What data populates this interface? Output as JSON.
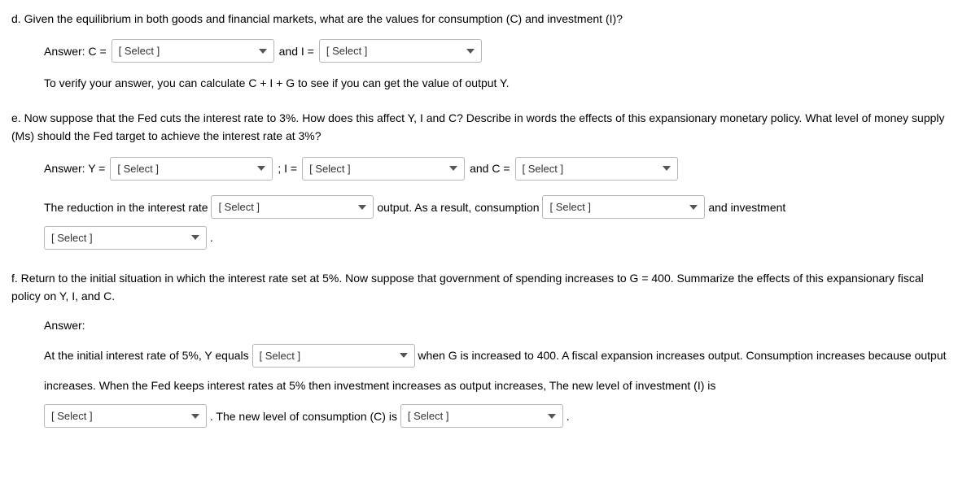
{
  "d": {
    "question": "d. Given the equilibrium in both goods and financial markets, what are the values for consumption (C) and investment (I)?",
    "answer_c_label": "Answer: C =",
    "and_i_label": "and I =",
    "verify": "To verify your answer, you can calculate C + I + G to see if you can get the value of output Y."
  },
  "e": {
    "question": "e. Now suppose that the Fed cuts the interest rate to 3%. How does this affect Y, I and C? Describe in words the effects of this expansionary monetary policy. What level of money supply (Ms) should the Fed target to achieve the interest rate at 3%?",
    "answer_y_label": "Answer: Y =",
    "i_label": "; I =",
    "and_c_label": "and C =",
    "reduction_text": "The reduction in the interest rate",
    "output_text": "output. As a result, consumption",
    "and_investment": "and investment",
    "period": "."
  },
  "f": {
    "question": "f. Return to the initial situation in which the interest rate set at 5%. Now suppose that government of spending increases to G = 400. Summarize the effects of this expansionary fiscal policy on Y, I, and C.",
    "answer_label": "Answer:",
    "text1": "At the initial interest rate of 5%, Y equals",
    "text2": "when G is increased to 400. A fiscal expansion increases output. Consumption",
    "text3": "increases because output increases. When the Fed keeps interest rates at 5% then investment increases as output increases, The new level of investment (I) is",
    "text4": ". The new level of consumption (C) is",
    "period": "."
  },
  "select_placeholder": "[ Select ]"
}
